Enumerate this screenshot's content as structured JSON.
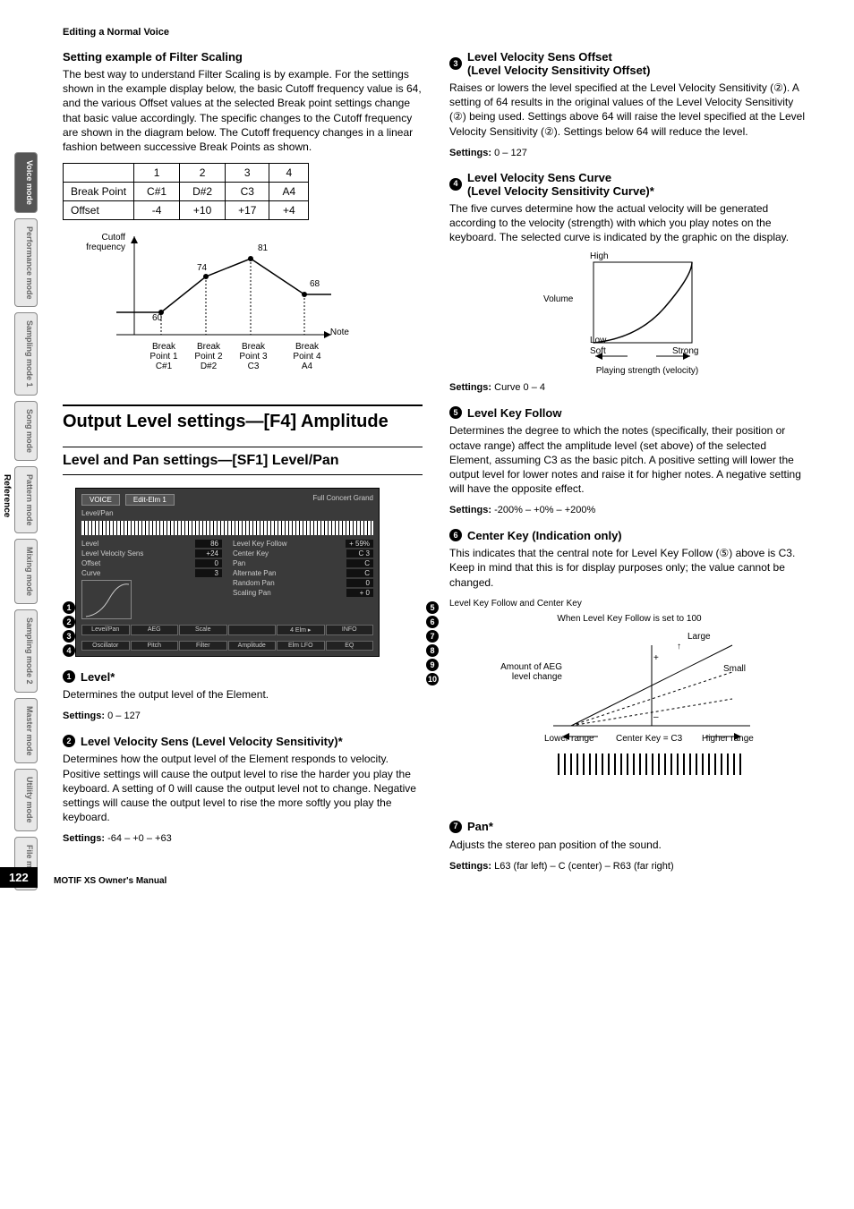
{
  "header": {
    "section": "Editing a Normal Voice"
  },
  "side_label": "Reference",
  "side_tabs": [
    {
      "label": "Voice mode",
      "active": true
    },
    {
      "label": "Performance mode",
      "active": false
    },
    {
      "label": "Sampling mode 1",
      "active": false
    },
    {
      "label": "Song mode",
      "active": false
    },
    {
      "label": "Pattern mode",
      "active": false
    },
    {
      "label": "Mixing mode",
      "active": false
    },
    {
      "label": "Sampling mode 2",
      "active": false
    },
    {
      "label": "Master mode",
      "active": false
    },
    {
      "label": "Utility mode",
      "active": false
    },
    {
      "label": "File mode",
      "active": false
    }
  ],
  "left": {
    "filter_scaling_title": "Setting example of Filter Scaling",
    "filter_scaling_para": "The best way to understand Filter Scaling is by example. For the settings shown in the example display below, the basic Cutoff frequency value is 64, and the various Offset values at the selected Break point settings change that basic value accordingly. The specific changes to the Cutoff frequency are shown in the diagram below. The Cutoff frequency changes in a linear fashion between successive Break Points as shown.",
    "table": {
      "cols": [
        "",
        "1",
        "2",
        "3",
        "4"
      ],
      "rows": [
        [
          "Break Point",
          "C#1",
          "D#2",
          "C3",
          "A4"
        ],
        [
          "Offset",
          "-4",
          "+10",
          "+17",
          "+4"
        ]
      ]
    },
    "graph": {
      "y_label": "Cutoff frequency",
      "x_label": "Note",
      "points": [
        {
          "label": "Break Point 1",
          "note": "C#1",
          "val": "60"
        },
        {
          "label": "Break Point 2",
          "note": "D#2",
          "val": "74"
        },
        {
          "label": "Break Point 3",
          "note": "C3",
          "val": "81"
        },
        {
          "label": "Break Point 4",
          "note": "A4",
          "val": "68"
        }
      ]
    },
    "h1": "Output Level settings—[F4] Amplitude",
    "h2": "Level and Pan settings—[SF1] Level/Pan",
    "screenshot": {
      "voice_chip": "VOICE",
      "edit_chip": "Edit-Elm 1",
      "title_right": "Full Concert Grand",
      "section_label": "Level/Pan",
      "left_params": [
        {
          "name": "Level",
          "val": "86"
        },
        {
          "name": "Level Velocity Sens",
          "val": "+24"
        },
        {
          "name": "Offset",
          "val": "0"
        },
        {
          "name": "Curve",
          "val": "3"
        }
      ],
      "right_params": [
        {
          "name": "Level Key Follow",
          "val": "+ 59%"
        },
        {
          "name": "Center Key",
          "val": "C 3"
        },
        {
          "name": "Pan",
          "val": "C"
        },
        {
          "name": "Alternate Pan",
          "val": "C"
        },
        {
          "name": "Random Pan",
          "val": "0"
        },
        {
          "name": "Scaling Pan",
          "val": "+ 0"
        }
      ],
      "bottom_tabs_row1": [
        "Level/Pan",
        "AEG",
        "Scale",
        "",
        "4 Elm ▸",
        "INFO"
      ],
      "bottom_tabs_row2": [
        "Oscillator",
        "Pitch",
        "Filter",
        "Amplitude",
        "Elm LFO",
        "EQ"
      ]
    },
    "param1": {
      "num": "1",
      "title": "Level*",
      "body": "Determines the output level of the Element.",
      "settings_label": "Settings:",
      "settings_val": "0 – 127"
    },
    "param2": {
      "num": "2",
      "title": "Level Velocity Sens (Level Velocity Sensitivity)*",
      "body": "Determines how the output level of the Element responds to velocity. Positive settings will cause the output level to rise the harder you play the keyboard. A setting of 0 will cause the output level not to change. Negative settings will cause the output level to rise the more softly you play the keyboard.",
      "settings_label": "Settings:",
      "settings_val": "-64 – +0 – +63"
    }
  },
  "right": {
    "param3": {
      "num": "3",
      "title": "Level Velocity Sens Offset",
      "subtitle": "(Level Velocity Sensitivity Offset)",
      "body": "Raises or lowers the level specified at the Level Velocity Sensitivity (②). A setting of 64 results in the original values of the Level Velocity Sensitivity (②) being used. Settings above 64 will raise the level specified at the Level Velocity Sensitivity (②). Settings below 64 will reduce the level.",
      "settings_label": "Settings:",
      "settings_val": "0 – 127"
    },
    "param4": {
      "num": "4",
      "title": "Level Velocity Sens Curve",
      "subtitle": "(Level Velocity Sensitivity Curve)*",
      "body": "The five curves determine how the actual velocity will be generated according to the velocity (strength) with which you play notes on the keyboard. The selected curve is indicated by the graphic on the display.",
      "curve_graph": {
        "y_high": "High",
        "y_low": "Low",
        "y_axis": "Volume",
        "x_left": "Soft",
        "x_right": "Strong",
        "x_axis": "Playing strength (velocity)"
      },
      "settings_label": "Settings:",
      "settings_val": "Curve 0 – 4"
    },
    "param5": {
      "num": "5",
      "title": "Level Key Follow",
      "body": "Determines the degree to which the notes (specifically, their position or octave range) affect the amplitude level (set above) of the selected Element, assuming C3 as the basic pitch. A positive setting will lower the output level for lower notes and raise it for higher notes. A negative setting will have the opposite effect.",
      "settings_label": "Settings:",
      "settings_val": "-200% – +0% – +200%"
    },
    "param6": {
      "num": "6",
      "title": "Center Key",
      "title_suffix": " (Indication only)",
      "body": "This indicates that the central note for Level Key Follow (⑤) above is C3. Keep in mind that this is for display purposes only; the value cannot be changed.",
      "diagram_title": "Level Key Follow and Center Key",
      "diagram": {
        "top_caption": "When Level Key Follow is set to 100",
        "left_label": "Amount of AEG level change",
        "large": "Large",
        "small": "Small",
        "plus": "+",
        "minus": "–",
        "lower": "Lower range",
        "center": "Center Key = C3",
        "higher": "Higher range"
      }
    },
    "param7": {
      "num": "7",
      "title": "Pan*",
      "body": "Adjusts the stereo pan position of the sound.",
      "settings_label": "Settings:",
      "settings_val": "L63 (far left) – C (center) – R63 (far right)"
    }
  },
  "footer": {
    "page": "122",
    "manual": "MOTIF XS Owner's Manual"
  }
}
